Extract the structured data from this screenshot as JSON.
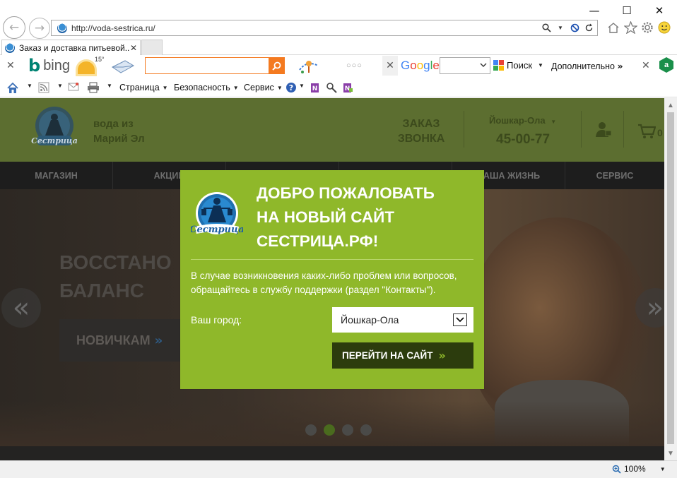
{
  "browser": {
    "url": "http://voda-sestrica.ru/",
    "tab_title": "Заказ и доставка питьевой...",
    "tab_close": "✕",
    "window_controls": {
      "minimize": "—",
      "maximize": "☐",
      "close": "✕"
    },
    "nav": {
      "back": "←",
      "forward": "→"
    },
    "zoom": "100%"
  },
  "toolbar": {
    "bing_label": "bing",
    "weather_temp": "15°",
    "google_label": "Google",
    "google_search": "Поиск",
    "more": "Дополнительно",
    "more_chevron": "»",
    "close_x": "✕",
    "dots": "○○○",
    "commands": {
      "page": "Страница",
      "safety": "Безопасность",
      "service": "Сервис"
    }
  },
  "site": {
    "slogan_line1": "вода из",
    "slogan_line2": "Марий Эл",
    "callback_line1": "ЗАКАЗ",
    "callback_line2": "ЗВОНКА",
    "city": "Йошкар-Ола",
    "phone": "45-00-77",
    "cart_count": "0",
    "nav": [
      {
        "label": "МАГАЗИН"
      },
      {
        "label": "АКЦИИ"
      },
      {
        "label": ""
      },
      {
        "label": ""
      },
      {
        "label": "НАША ЖИЗНЬ"
      },
      {
        "label": "СЕРВИС"
      }
    ],
    "hero": {
      "title_line1": "ВОССТАНО",
      "title_line2": "БАЛАНС",
      "button": "НОВИЧКАМ",
      "button_chevron": "»",
      "prev": "«",
      "next": "»"
    }
  },
  "modal": {
    "title_line1": "ДОБРО ПОЖАЛОВАТЬ",
    "title_line2": "НА НОВЫЙ САЙТ",
    "title_line3": "СЕСТРИЦА.РФ!",
    "text": "В случае возникновения каких-либо проблем или вопросов, обращайтесь в службу поддержки (раздел \"Контакты\").",
    "city_label": "Ваш город:",
    "city_value": "Йошкар-Ола",
    "go_button": "ПЕРЕЙТИ НА САЙТ",
    "go_chevron": "»",
    "logo_text": "Сестрица"
  },
  "colors": {
    "modal_bg": "#8fb82a",
    "header_bg": "#5c6e30",
    "nav_bg": "#1d1d1d",
    "button_dark": "#2c3c0d"
  }
}
